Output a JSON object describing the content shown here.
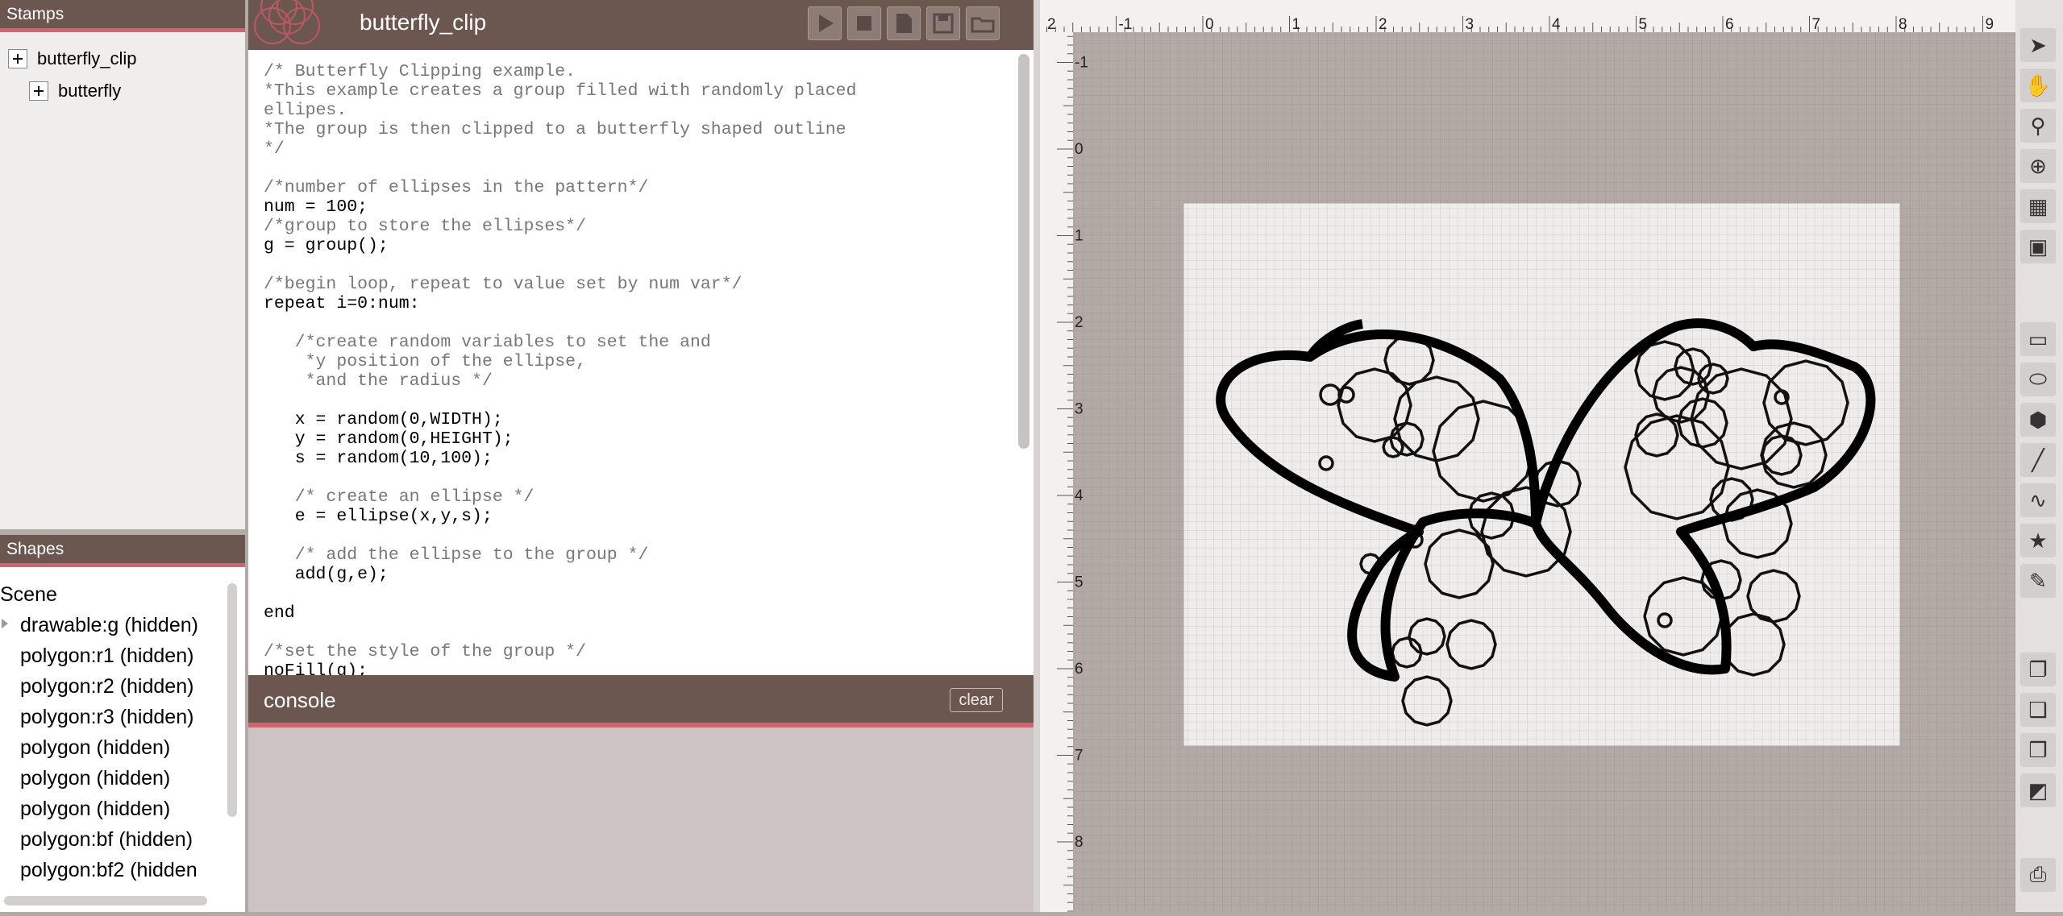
{
  "stamps": {
    "title": "Stamps",
    "items": [
      {
        "label": "butterfly_clip"
      },
      {
        "label": "butterfly"
      }
    ]
  },
  "shapes": {
    "title": "Shapes",
    "scene_label": "Scene",
    "rows": [
      "drawable:g (hidden)",
      "polygon:r1 (hidden)",
      "polygon:r2 (hidden)",
      "polygon:r3 (hidden)",
      "polygon (hidden)",
      "polygon (hidden)",
      "polygon (hidden)",
      "polygon:bf (hidden)",
      "polygon:bf2 (hidden"
    ]
  },
  "editor": {
    "title": "butterfly_clip",
    "toolbar": [
      "play-icon",
      "stop-icon",
      "new-file-icon",
      "save-icon",
      "open-folder-icon"
    ]
  },
  "code": [
    {
      "t": "/* Butterfly Clipping example.",
      "c": true
    },
    {
      "t": "*This example creates a group filled with randomly placed",
      "c": true
    },
    {
      "t": "ellipes.",
      "c": true
    },
    {
      "t": "*The group is then clipped to a butterfly shaped outline",
      "c": true
    },
    {
      "t": "*/",
      "c": true
    },
    {
      "t": "",
      "c": false
    },
    {
      "t": "/*number of ellipses in the pattern*/",
      "c": true
    },
    {
      "t": "num = 100;",
      "c": false
    },
    {
      "t": "/*group to store the ellipses*/",
      "c": true
    },
    {
      "t": "g = group();",
      "c": false
    },
    {
      "t": "",
      "c": false
    },
    {
      "t": "/*begin loop, repeat to value set by num var*/",
      "c": true
    },
    {
      "t": "repeat i=0:num:",
      "c": false
    },
    {
      "t": "",
      "c": false
    },
    {
      "t": "   /*create random variables to set the and",
      "c": true
    },
    {
      "t": "    *y position of the ellipse,",
      "c": true
    },
    {
      "t": "    *and the radius */",
      "c": true
    },
    {
      "t": "",
      "c": false
    },
    {
      "t": "   x = random(0,WIDTH);",
      "c": false
    },
    {
      "t": "   y = random(0,HEIGHT);",
      "c": false
    },
    {
      "t": "   s = random(10,100);",
      "c": false
    },
    {
      "t": "",
      "c": false
    },
    {
      "t": "   /* create an ellipse */",
      "c": true
    },
    {
      "t": "   e = ellipse(x,y,s);",
      "c": false
    },
    {
      "t": "",
      "c": false
    },
    {
      "t": "   /* add the ellipse to the group */",
      "c": true
    },
    {
      "t": "   add(g,e);",
      "c": false
    },
    {
      "t": "",
      "c": false
    },
    {
      "t": "end",
      "c": false
    },
    {
      "t": "",
      "c": false
    },
    {
      "t": "/*set the style of the group */",
      "c": true
    },
    {
      "t": "noFill(g);",
      "c": false
    }
  ],
  "console": {
    "title": "console",
    "clear_label": "clear"
  },
  "ruler": {
    "top_labels": [
      "2",
      "-1",
      "0",
      "1",
      "2",
      "3",
      "4",
      "5",
      "6",
      "7",
      "8",
      "9"
    ],
    "left_labels": [
      "-1",
      "0",
      "1",
      "2",
      "3",
      "4",
      "5",
      "6",
      "7",
      "8"
    ]
  },
  "right_tools": [
    "pointer-icon",
    "hand-icon",
    "zoom-icon",
    "target-icon",
    "grid-icon",
    "crop-icon",
    "rectangle-icon",
    "ellipse-icon",
    "polygon-icon",
    "line-icon",
    "curve-icon",
    "star-icon",
    "pen-icon",
    "bring-front-icon",
    "send-back-icon",
    "move-forward-icon",
    "move-backward-icon",
    "print-icon"
  ],
  "colors": {
    "header": "#6b5650",
    "accent": "#d0656f",
    "canvas_bg": "#b3aaa6"
  }
}
